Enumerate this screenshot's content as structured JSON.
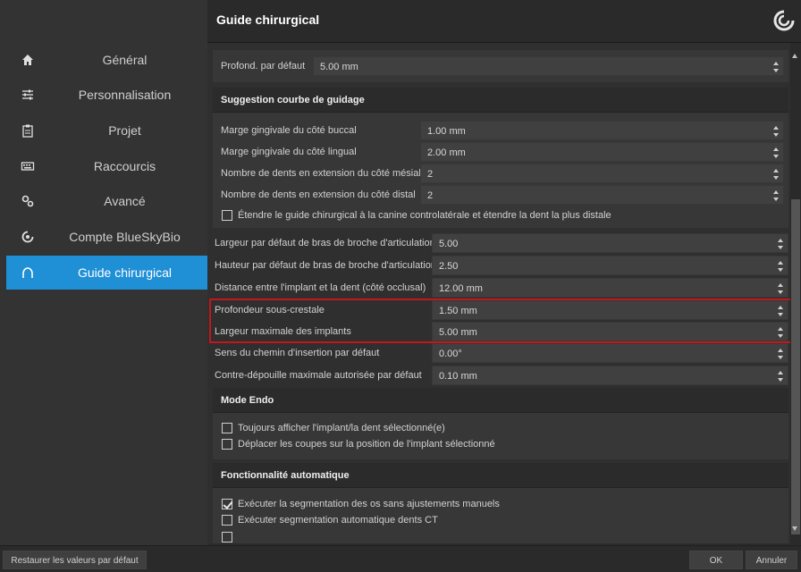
{
  "sidebar": {
    "items": [
      {
        "label": "Général",
        "icon": "home-icon"
      },
      {
        "label": "Personnalisation",
        "icon": "sliders-icon"
      },
      {
        "label": "Projet",
        "icon": "clipboard-icon"
      },
      {
        "label": "Raccourcis",
        "icon": "keyboard-icon"
      },
      {
        "label": "Avancé",
        "icon": "gears-icon"
      },
      {
        "label": "Compte BlueSkyBio",
        "icon": "blueskybio-icon"
      },
      {
        "label": "Guide chirurgical",
        "icon": "arch-icon",
        "active": true
      }
    ]
  },
  "header": {
    "title": "Guide chirurgical"
  },
  "settings": {
    "default_depth": {
      "label": "Profond. par défaut",
      "value": "5.00 mm"
    },
    "curve_group": {
      "title": "Suggestion courbe de guidage",
      "buccal": {
        "label": "Marge gingivale du côté buccal",
        "value": "1.00 mm"
      },
      "lingual": {
        "label": "Marge gingivale du côté lingual",
        "value": "2.00 mm"
      },
      "mesial": {
        "label": "Nombre de dents en extension du côté mésial",
        "value": "2"
      },
      "distal": {
        "label": "Nombre de dents en extension du côté distal",
        "value": "2"
      },
      "extend_check": {
        "label": "Étendre le guide chirurgical à la canine controlatérale et étendre la dent la plus distale",
        "checked": false
      }
    },
    "pin_width": {
      "label": "Largeur par défaut de bras de broche d'articulation",
      "value": "5.00"
    },
    "pin_height": {
      "label": "Hauteur par défaut de bras de broche d'articulation",
      "value": "2.50"
    },
    "implant_distance": {
      "label": "Distance entre l'implant et la dent (côté occlusal)",
      "value": "12.00 mm"
    },
    "subcrestal": {
      "label": "Profondeur sous-crestale",
      "value": "1.50 mm"
    },
    "max_width": {
      "label": "Largeur maximale des implants",
      "value": "5.00 mm"
    },
    "insertion_path": {
      "label": "Sens du chemin d'insertion par défaut",
      "value": "0.00°"
    },
    "undercut": {
      "label": "Contre-dépouille maximale autorisée par défaut",
      "value": "0.10 mm"
    },
    "endo_group": {
      "title": "Mode Endo",
      "show_selected": {
        "label": "Toujours afficher l'implant/la dent sélectionné(e)",
        "checked": false
      },
      "move_slices": {
        "label": "Déplacer les coupes sur la position de l'implant sélectionné",
        "checked": false
      }
    },
    "auto_group": {
      "title": "Fonctionnalité automatique",
      "bone_seg": {
        "label": "Exécuter la segmentation des os sans ajustements manuels",
        "checked": true
      },
      "teeth_seg": {
        "label": "Exécuter segmentation automatique dents CT",
        "checked": false
      }
    }
  },
  "footer": {
    "restore_label": "Restaurer les valeurs par défaut",
    "ok_label": "OK",
    "cancel_label": "Annuler"
  },
  "colors": {
    "accent": "#1f8fd6",
    "highlight": "#c4161c"
  }
}
